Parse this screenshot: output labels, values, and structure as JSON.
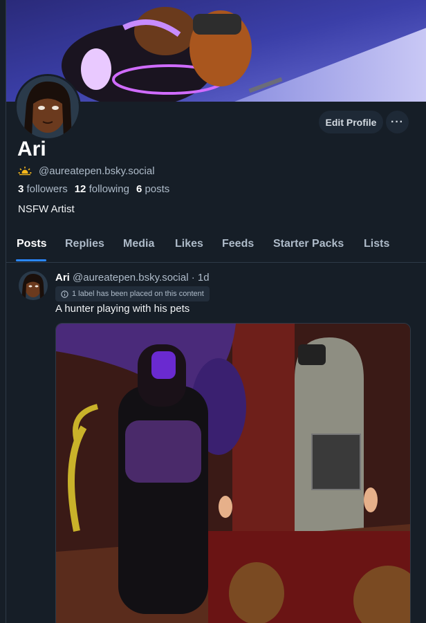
{
  "profile": {
    "name": "Ari",
    "handle": "@aureatepen.bsky.social",
    "followers_count": "3",
    "followers_label": "followers",
    "following_count": "12",
    "following_label": "following",
    "posts_count": "6",
    "posts_label": "posts",
    "bio": "NSFW Artist",
    "edit_label": "Edit Profile",
    "more_label": "···"
  },
  "tabs": [
    "Posts",
    "Replies",
    "Media",
    "Likes",
    "Feeds",
    "Starter Packs",
    "Lists"
  ],
  "post": {
    "author": "Ari",
    "handle": "@aureatepen.bsky.social",
    "time": "· 1d",
    "label_notice": "1 label has been placed on this content",
    "text": "A hunter playing with his pets"
  },
  "colors": {
    "background": "#161e27",
    "accent": "#2a87ff",
    "button": "#1e2936"
  }
}
